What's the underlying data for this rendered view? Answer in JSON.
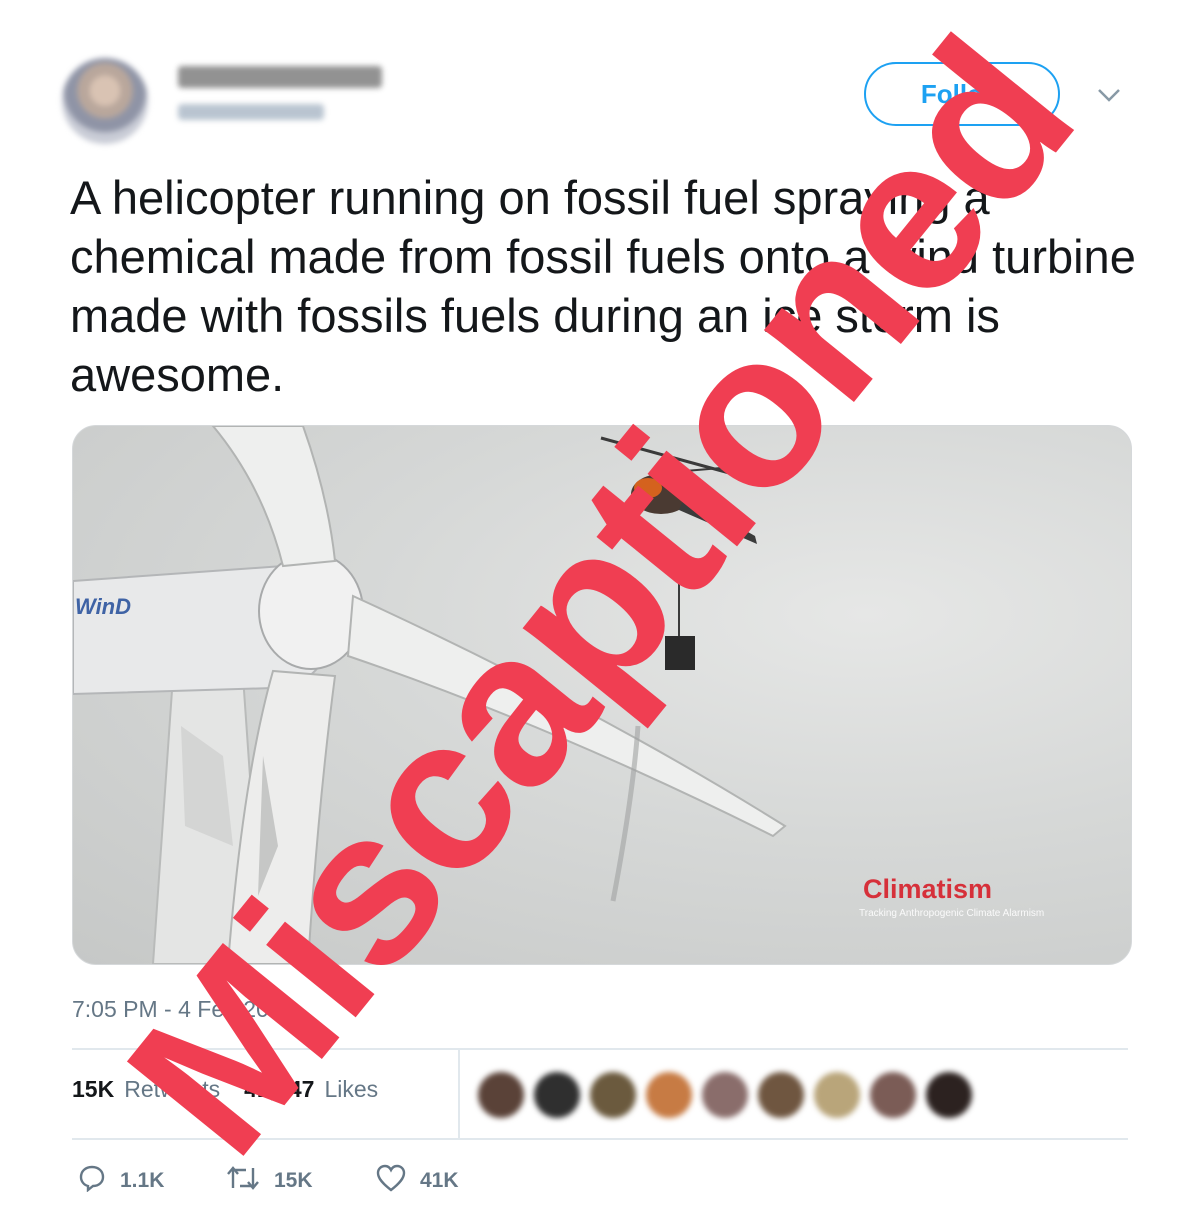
{
  "header": {
    "follow_label": "Follow"
  },
  "tweet": {
    "text": "A helicopter running on fossil fuel spraying a chemical made from fossil fuels onto a wind turbine made with fossils fuels during an ice storm is awesome.",
    "timestamp": "7:05 PM - 4 Feb 2021"
  },
  "media": {
    "brand": "Climatism",
    "brand_sub": "Tracking Anthropogenic Climate Alarmism",
    "turbine_logo": "WinD"
  },
  "stats": {
    "retweets_count": "15K",
    "retweets_label": "Retweets",
    "likes_count": "41,247",
    "likes_label": "Likes"
  },
  "actions": {
    "reply_count": "1.1K",
    "retweet_count": "15K",
    "like_count": "41K"
  },
  "overlay": {
    "stamp_text": "Miscaptioned",
    "stamp_color": "#f03e52"
  },
  "colors": {
    "accent": "#1da1f2",
    "brand": "#d6303a",
    "muted": "#657786"
  },
  "icons": {
    "reply": "reply-icon",
    "retweet": "retweet-icon",
    "like": "heart-icon",
    "more": "chevron-down-icon"
  }
}
